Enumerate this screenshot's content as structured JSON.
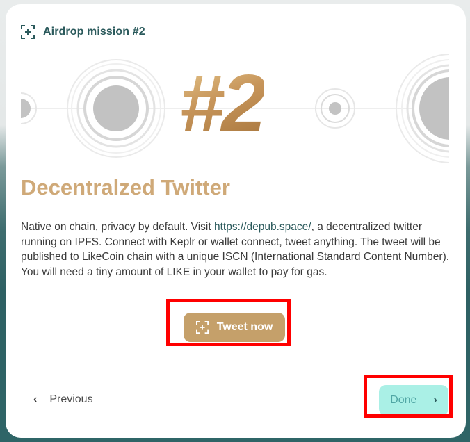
{
  "header": {
    "title": "Airdrop mission #2",
    "icon": "scan-plus-icon"
  },
  "banner": {
    "number": "#2"
  },
  "mission": {
    "heading": "Decentralzed Twitter",
    "desc_part1": "Native on chain, privacy by default. Visit ",
    "link_text": "https://depub.space/",
    "desc_part2": ", a decentralized twitter running on IPFS. Connect with Keplr or wallet connect, tweet anything. The tweet will be published to LikeCoin chain with a unique ISCN (International Standard Content Number).",
    "desc_line2": "You will need a tiny amount of LIKE in your wallet to pay for gas."
  },
  "actions": {
    "tweet_label": "Tweet now",
    "previous_label": "Previous",
    "done_label": "Done"
  },
  "colors": {
    "accent_gold": "#c5a06a",
    "heading_gold": "#cfa978",
    "teal_dark": "#2b5a5c",
    "done_bg": "#aaf0e6",
    "highlight": "#ff0000"
  }
}
